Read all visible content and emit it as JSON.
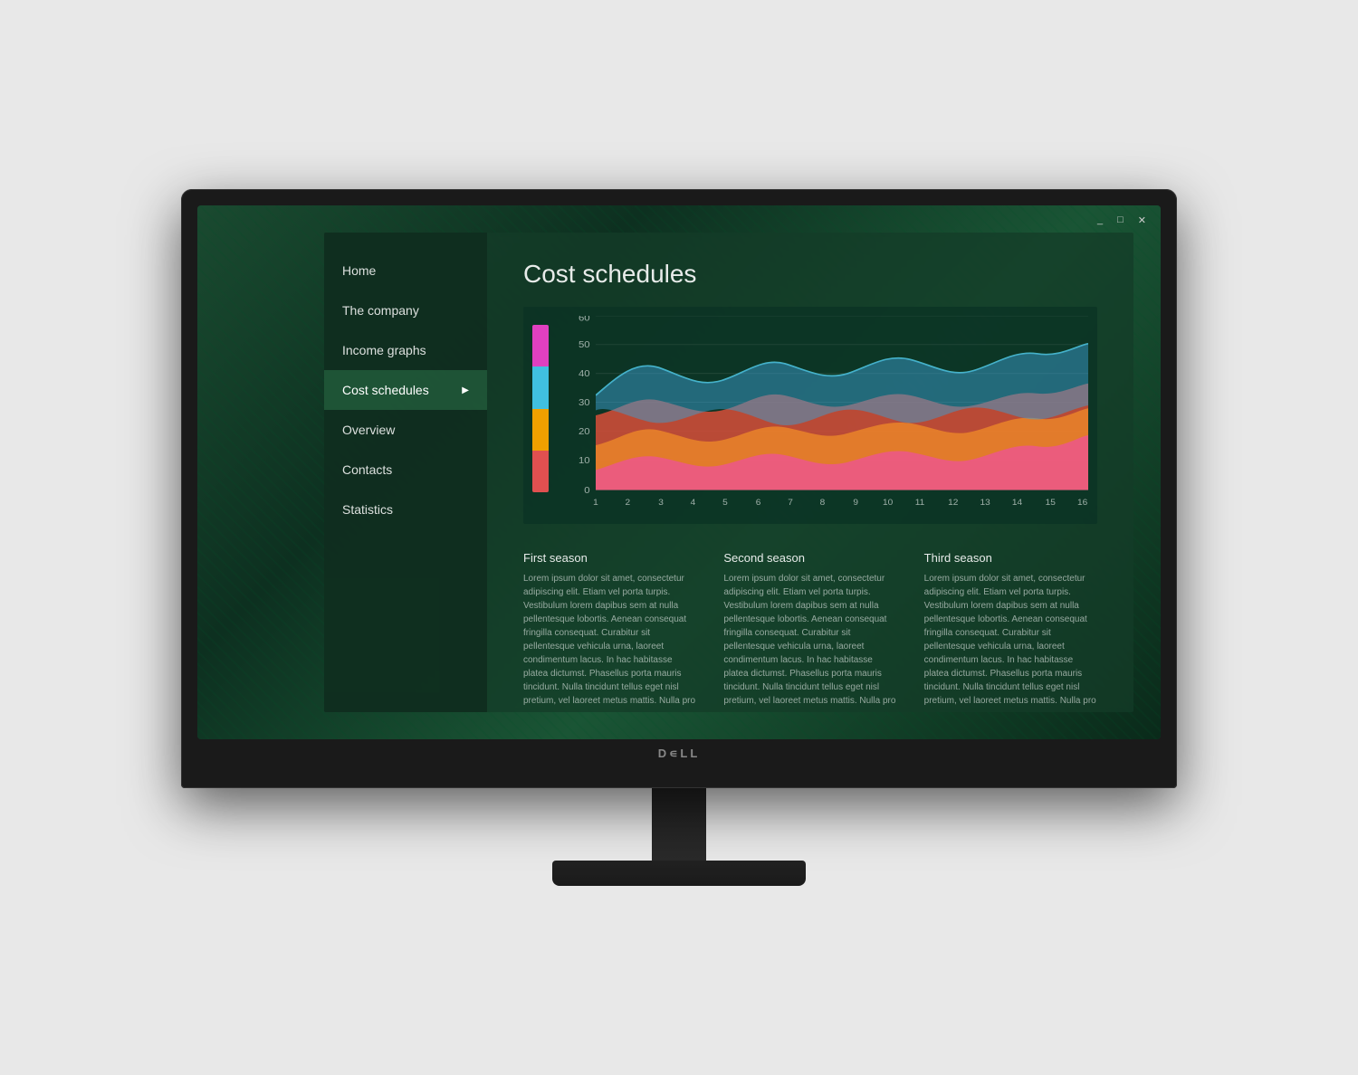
{
  "window": {
    "controls": {
      "minimize": "_",
      "maximize": "□",
      "close": "✕"
    }
  },
  "sidebar": {
    "items": [
      {
        "id": "home",
        "label": "Home",
        "active": false
      },
      {
        "id": "the-company",
        "label": "The company",
        "active": false
      },
      {
        "id": "income-graphs",
        "label": "Income graphs",
        "active": false
      },
      {
        "id": "cost-schedules",
        "label": "Cost schedules",
        "active": true
      },
      {
        "id": "overview",
        "label": "Overview",
        "active": false
      },
      {
        "id": "contacts",
        "label": "Contacts",
        "active": false
      },
      {
        "id": "statistics",
        "label": "Statistics",
        "active": false
      }
    ]
  },
  "main": {
    "page_title": "Cost schedules",
    "chart": {
      "y_labels": [
        "60",
        "50",
        "40",
        "30",
        "20",
        "10",
        "0"
      ],
      "x_labels": [
        "1",
        "2",
        "3",
        "4",
        "5",
        "6",
        "7",
        "8",
        "9",
        "10",
        "11",
        "12",
        "13",
        "14",
        "15",
        "16"
      ]
    },
    "seasons": [
      {
        "title": "First season",
        "text": "Lorem ipsum dolor sit amet, consectetur adipiscing elit. Etiam vel porta turpis. Vestibulum lorem dapibus sem at nulla pellentesque lobortis. Aenean consequat fringilla consequat. Curabitur sit pellentesque vehicula urna, laoreet condimentum lacus. In hac habitasse platea dictumst. Phasellus porta mauris tincidunt. Nulla tincidunt tellus eget nisl pretium, vel laoreet metus mattis. Nulla pro"
      },
      {
        "title": "Second season",
        "text": "Lorem ipsum dolor sit amet, consectetur adipiscing elit. Etiam vel porta turpis. Vestibulum lorem dapibus sem at nulla pellentesque lobortis. Aenean consequat fringilla consequat. Curabitur sit pellentesque vehicula urna, laoreet condimentum lacus. In hac habitasse platea dictumst. Phasellus porta mauris tincidunt. Nulla tincidunt tellus eget nisl pretium, vel laoreet metus mattis. Nulla pro"
      },
      {
        "title": "Third season",
        "text": "Lorem ipsum dolor sit amet, consectetur adipiscing elit. Etiam vel porta turpis. Vestibulum lorem dapibus sem at nulla pellentesque lobortis. Aenean consequat fringilla consequat. Curabitur sit pellentesque vehicula urna, laoreet condimentum lacus. In hac habitasse platea dictumst. Phasellus porta mauris tincidunt. Nulla tincidunt tellus eget nisl pretium, vel laoreet metus mattis. Nulla pro"
      }
    ]
  },
  "monitor": {
    "brand": "D∊LL"
  }
}
